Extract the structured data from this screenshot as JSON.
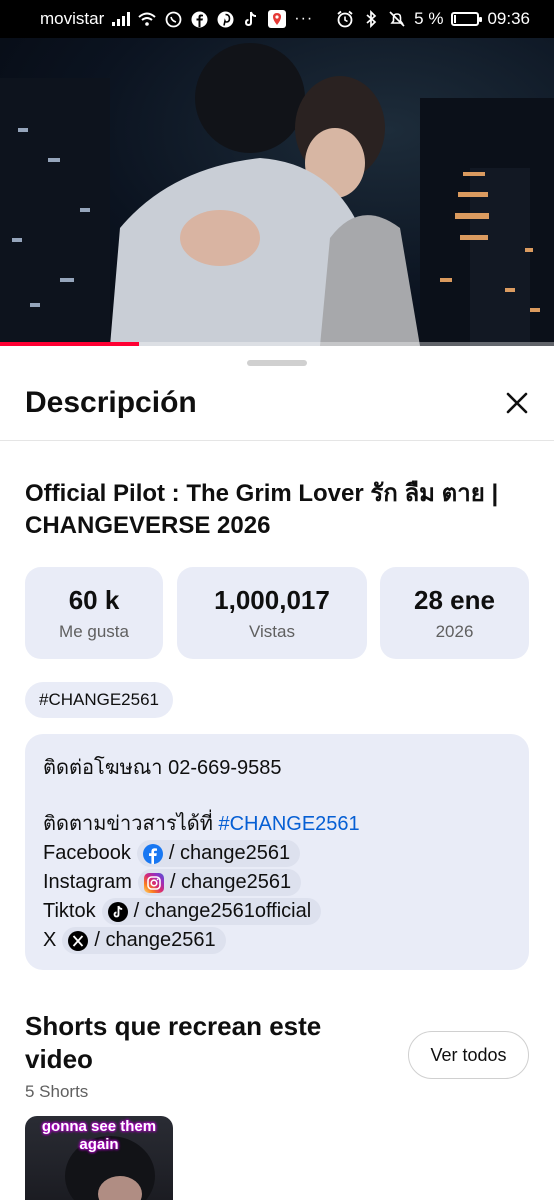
{
  "status_bar": {
    "carrier": "movistar",
    "battery": "5 %",
    "time": "09:36",
    "more": "···"
  },
  "video": {
    "progress": 0.25
  },
  "sheet": {
    "title": "Descripción",
    "video_title": "Official Pilot : The Grim Lover รัก ลืม ตาย | CHANGEVERSE 2026",
    "stats": [
      {
        "value": "60 k",
        "label": "Me gusta"
      },
      {
        "value": "1,000,017",
        "label": "Vistas"
      },
      {
        "value": "28 ene",
        "label": "2026"
      }
    ],
    "tag": "#CHANGE2561",
    "description": {
      "line1": "ติดต่อโฆษณา 02-669-9585",
      "line2_prefix": "ติดตามข่าวสารได้ที่ ",
      "line2_link": "#CHANGE2561",
      "socials": [
        {
          "name": "Facebook",
          "handle": "/ change2561",
          "icon": "facebook-icon"
        },
        {
          "name": "Instagram",
          "handle": "/ change2561",
          "icon": "instagram-icon"
        },
        {
          "name": "Tiktok",
          "handle": "/ change2561official",
          "icon": "tiktok-icon"
        },
        {
          "name": "X",
          "handle": "/ change2561",
          "icon": "x-icon"
        }
      ]
    },
    "shorts": {
      "title": "Shorts que recrean este video",
      "count": "5 Shorts",
      "view_all": "Ver todos",
      "first_caption": "gonna see them again"
    }
  },
  "colors": {
    "accent_link": "#065fd4",
    "progress": "#ff0033",
    "chip_bg": "#e9ecf7"
  }
}
